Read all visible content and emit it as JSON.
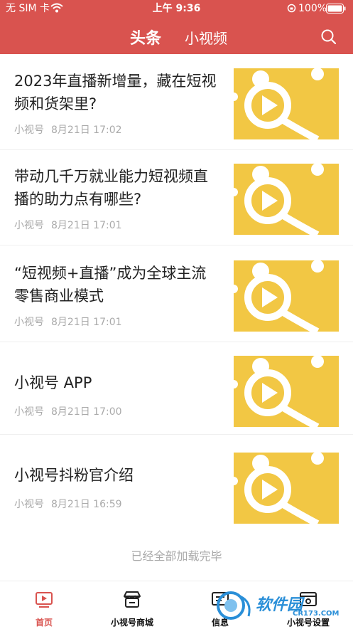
{
  "status_bar": {
    "carrier": "无 SIM 卡",
    "time": "上午 9:36",
    "battery": "100%"
  },
  "nav": {
    "tabs": [
      "头条",
      "小视频"
    ],
    "active_tab": 0
  },
  "feed": [
    {
      "title": "2023年直播新增量，藏在短视频和货架里?",
      "source": "小视号",
      "date": "8月21日 17:02"
    },
    {
      "title": "带动几千万就业能力短视频直播的助力点有哪些?",
      "source": "小视号",
      "date": "8月21日 17:01"
    },
    {
      "title": "“短视频+直播”成为全球主流零售商业模式",
      "source": "小视号",
      "date": "8月21日 17:01"
    },
    {
      "title": "小视号 APP",
      "source": "小视号",
      "date": "8月21日 17:00"
    },
    {
      "title": "小视号抖粉官介绍",
      "source": "小视号",
      "date": "8月21日 16:59"
    }
  ],
  "end_text": "已经全部加载完毕",
  "tabbar": {
    "items": [
      {
        "label": "首页",
        "icon": "home-play-icon",
        "active": true
      },
      {
        "label": "小视号商城",
        "icon": "store-icon",
        "active": false
      },
      {
        "label": "信息",
        "icon": "message-icon",
        "active": false
      },
      {
        "label": "小视号设置",
        "icon": "settings-icon",
        "active": false
      }
    ]
  },
  "watermark": {
    "site": "软件园",
    "url": "CR173.COM"
  },
  "colors": {
    "header": "#d9534f",
    "thumb_yellow": "#f2c744",
    "active_tab": "#d9534f"
  }
}
